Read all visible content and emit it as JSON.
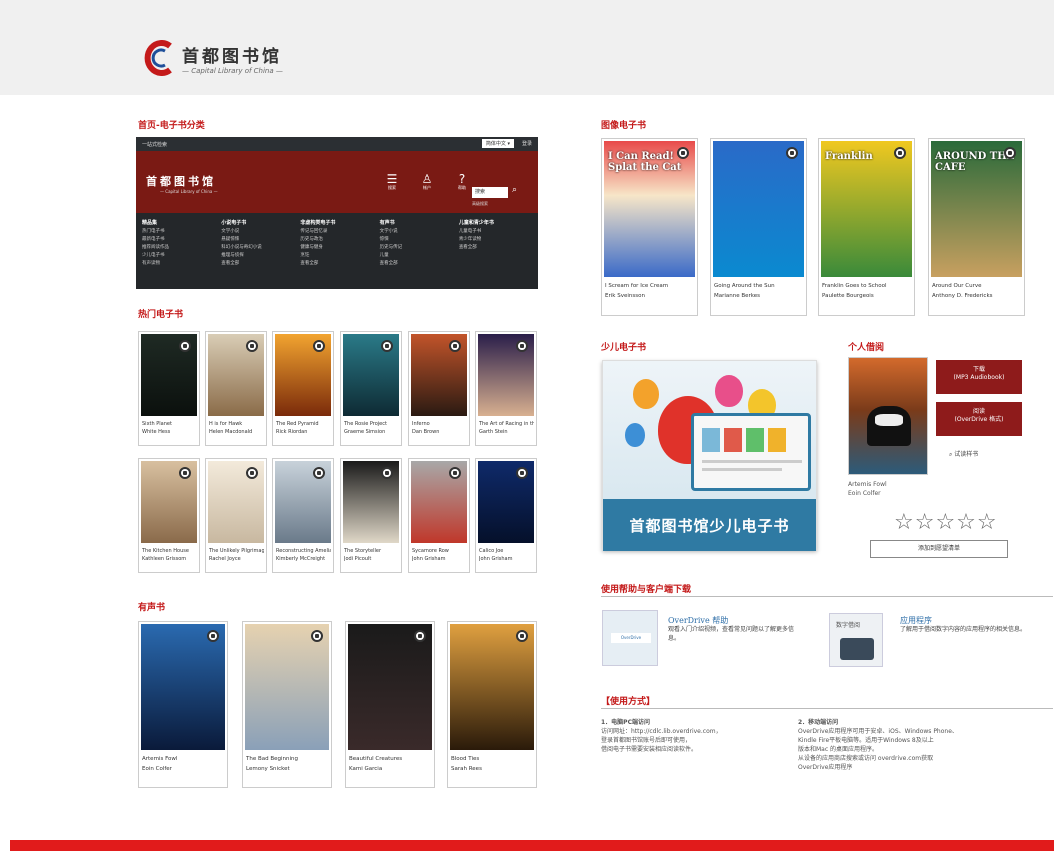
{
  "header": {
    "logo_cn": "首都图书馆",
    "logo_en": "— Capital Library of China —"
  },
  "sections": {
    "home_category": "首页-电子书分类",
    "hot": "热门电子书",
    "audio": "有声书",
    "picture": "图像电子书",
    "kids": "少儿电子书",
    "personal": "个人借阅",
    "help": "使用帮助与客户端下载",
    "usage": "【使用方式】"
  },
  "site": {
    "topbar": "一站式检索",
    "lang": "简体中文 ▾",
    "login": "登录",
    "logo": "首都图书馆",
    "logo_en": "— Capital Library of China —",
    "icons": [
      {
        "glyph": "☰",
        "label": "搜索"
      },
      {
        "glyph": "♙",
        "label": "帐户"
      },
      {
        "glyph": "?",
        "label": "帮助"
      }
    ],
    "search_placeholder": "搜索",
    "adv_search": "高级搜索",
    "menu": [
      {
        "head": "精品集",
        "items": [
          "热门电子书",
          "最新电子书",
          "推荐阅读作品",
          "少儿电子书",
          "有声读物"
        ]
      },
      {
        "head": "小说电子书",
        "items": [
          "文学小说",
          "悬疑惊悚",
          "科幻小说与奇幻小说",
          "推理与侦探",
          "查看全部"
        ]
      },
      {
        "head": "非虚构类电子书",
        "items": [
          "传记与回忆录",
          "历史与政治",
          "健康与健身",
          "烹饪",
          "查看全部"
        ]
      },
      {
        "head": "有声书",
        "items": [
          "文学小说",
          "惊悚",
          "历史与传记",
          "儿童",
          "查看全部"
        ]
      },
      {
        "head": "儿童和青少年书",
        "items": [
          "儿童电子书",
          "青少年读物",
          "查看全部"
        ]
      }
    ]
  },
  "hot_books": [
    {
      "title": "Sixth Planet",
      "author": "White Hess"
    },
    {
      "title": "H is for Hawk",
      "author": "Helen Macdonald"
    },
    {
      "title": "The Red Pyramid",
      "author": "Rick Riordan"
    },
    {
      "title": "The Rosie Project",
      "author": "Graeme Simsion"
    },
    {
      "title": "Inferno",
      "author": "Dan Brown"
    },
    {
      "title": "The Art of Racing in the Rain",
      "author": "Garth Stein"
    },
    {
      "title": "The Kitchen House",
      "author": "Kathleen Grissom"
    },
    {
      "title": "The Unlikely Pilgrimage of Harold Fry",
      "author": "Rachel Joyce"
    },
    {
      "title": "Reconstructing Amelia",
      "author": "Kimberly McCreight"
    },
    {
      "title": "The Storyteller",
      "author": "Jodi Picoult"
    },
    {
      "title": "Sycamore Row",
      "author": "John Grisham"
    },
    {
      "title": "Calico Joe",
      "author": "John Grisham"
    }
  ],
  "audio_books": [
    {
      "title": "Artemis Fowl",
      "author": "Eoin Colfer"
    },
    {
      "title": "The Bad Beginning",
      "author": "Lemony Snicket"
    },
    {
      "title": "Beautiful Creatures",
      "author": "Kami Garcia"
    },
    {
      "title": "Blood Ties",
      "author": "Sarah Rees"
    }
  ],
  "picture_books": [
    {
      "title": "I Scream for Ice Cream",
      "author": "Erik Sveinsson",
      "cover_text": "I Can Read! Splat the Cat"
    },
    {
      "title": "Going Around the Sun",
      "author": "Marianne Berkes",
      "cover_text": ""
    },
    {
      "title": "Franklin Goes to School",
      "author": "Paulette Bourgeois",
      "cover_text": "Franklin"
    },
    {
      "title": "Around Our Curve",
      "author": "Anthony D. Fredericks",
      "cover_text": "AROUND THE CAFE"
    }
  ],
  "kids_banner": "首都图书馆少儿电子书",
  "personal": {
    "download": "下载",
    "download_sub": "(MP3 Audiobook)",
    "read": "阅读",
    "read_sub": "(OverDrive 格式)",
    "try_read": "试读样书",
    "book_title": "Artemis Fowl",
    "book_author": "Eoin Colfer",
    "stars": "☆☆☆☆☆",
    "wait_button": "添加到愿望清单"
  },
  "help": {
    "overdrive_title": "OverDrive 帮助",
    "overdrive_body": "观看入门介绍视频，查看常见问题以了解更多信息。",
    "app_title": "应用程序",
    "app_body": "了解用于借阅数字内容的应用程序的相关信息。",
    "app_icon_label": "数字借阅"
  },
  "usage": {
    "pc_title": "1．电脑PC端访问",
    "pc_body": [
      "访问网址：http://cdlc.lib.overdrive.com，",
      "登录首都图书馆账号后即可使用，",
      "借阅电子书需要安装相应阅读软件。"
    ],
    "mobile_title": "2．移动端访问",
    "mobile_body": [
      "OverDrive应用程序可用于安卓、iOS、Windows Phone、",
      "Kindle Fire平板电脑等。适用于Windows 8及以上",
      "版本和Mac 的桌面应用程序。",
      "从设备的应用商店搜索或访问 overdrive.com获取",
      "OverDrive应用程序"
    ]
  },
  "colors": {
    "brand_red": "#c41a1a",
    "dark_red": "#7a1a14",
    "footer_red": "#e11b1b",
    "blue": "#2f7aa3"
  }
}
